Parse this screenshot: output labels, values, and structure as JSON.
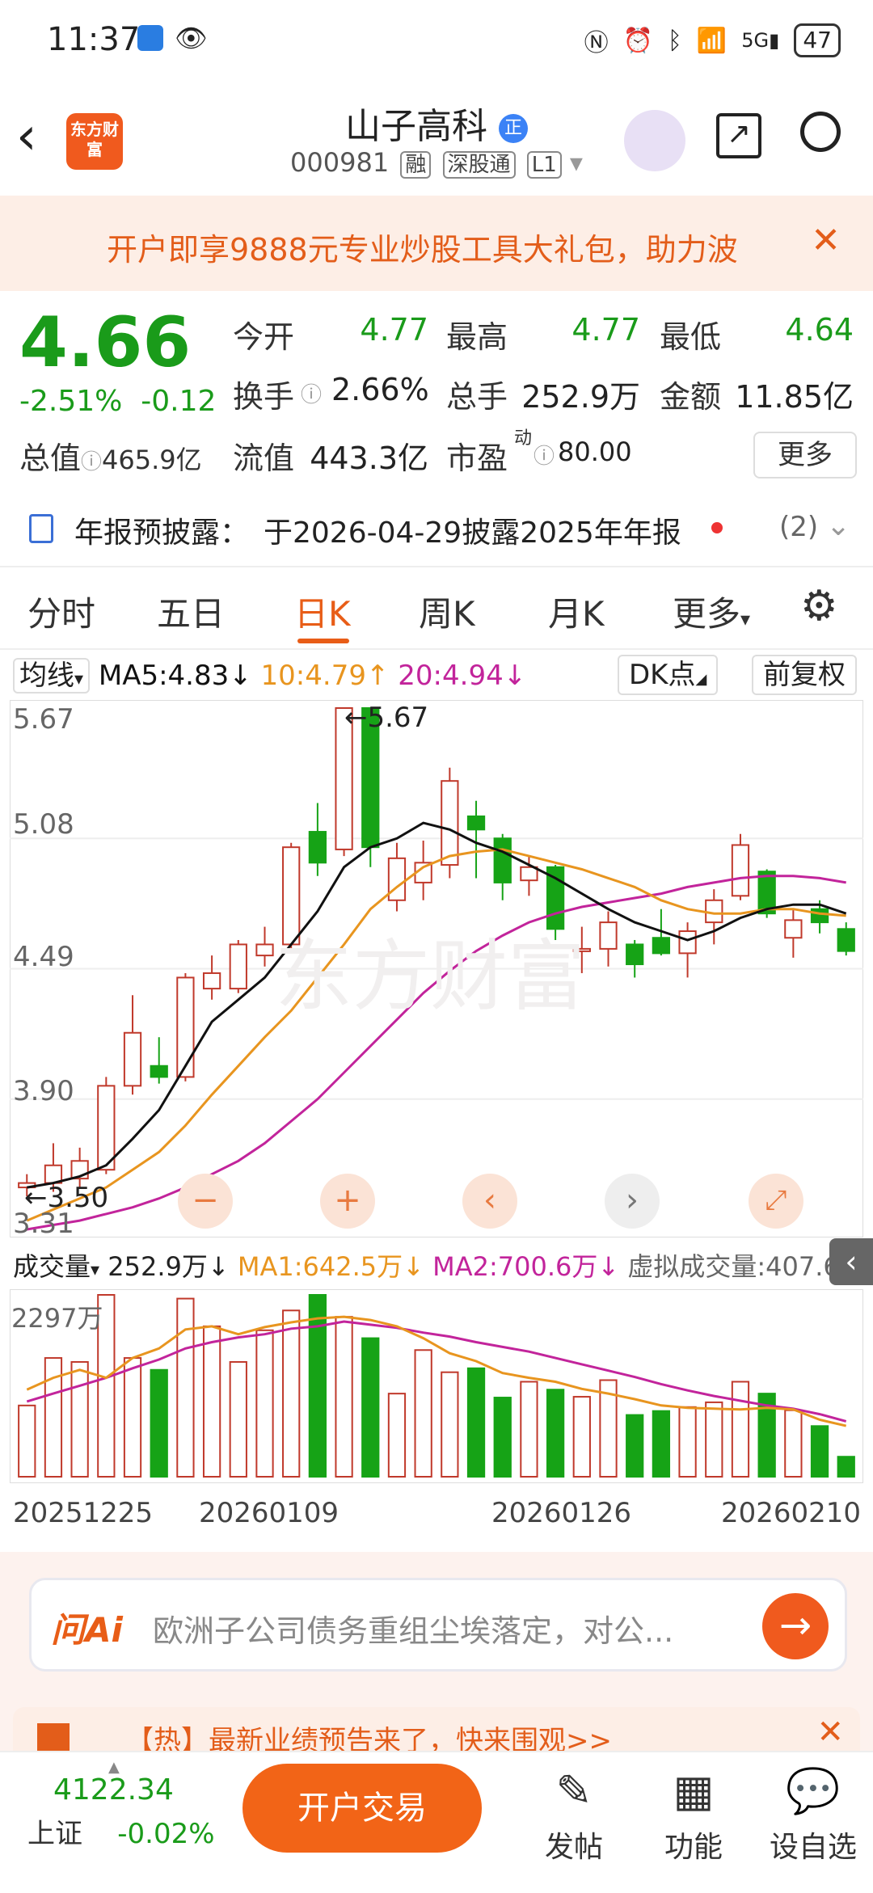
{
  "status_bar": {
    "time": "11:37",
    "battery": "47"
  },
  "header": {
    "logo": "东方财富",
    "title": "山子高科",
    "badge": "正",
    "code": "000981",
    "tags": [
      "融",
      "深股通",
      "L1"
    ]
  },
  "banner": {
    "text": "开户即享9888元专业炒股工具大礼包，助力波"
  },
  "quote": {
    "price": "4.66",
    "change_pct": "-2.51%",
    "change": "-0.12",
    "open_label": "今开",
    "open": "4.77",
    "high_label": "最高",
    "high": "4.77",
    "low_label": "最低",
    "low": "4.64",
    "turnover_label": "换手",
    "turnover": "2.66%",
    "volume_label": "总手",
    "volume": "252.9万",
    "amount_label": "金额",
    "amount": "11.85亿",
    "mktcap_label": "总值",
    "mktcap": "465.9亿",
    "float_label": "流值",
    "float": "443.3亿",
    "pe_label": "市盈",
    "pe_sup": "动",
    "pe": "80.00",
    "more": "更多"
  },
  "notice": {
    "label": "年报预披露：",
    "text": "于2026-04-29披露2025年年报",
    "count": "(2)"
  },
  "tabs": [
    "分时",
    "五日",
    "日K",
    "周K",
    "月K",
    "更多"
  ],
  "active_tab": "日K",
  "indicators": {
    "ma_selector": "均线",
    "ma5": "MA5:4.83↓",
    "ma10": "10:4.79↑",
    "ma20": "20:4.94↓",
    "dk": "DK点",
    "adjust": "前复权"
  },
  "price_axis": [
    "5.67",
    "5.08",
    "4.49",
    "3.90",
    "3.31"
  ],
  "annotations": {
    "high": "←5.67",
    "low": "←3.50"
  },
  "watermark": "东方财富",
  "volume_bar": {
    "selector": "成交量",
    "vol": "252.9万↓",
    "ma1": "MA1:642.5万↓",
    "ma2": "MA2:700.6万↓",
    "virtual": "虚拟成交量:407.6万",
    "max_label": "2297万"
  },
  "dates": [
    "20251225",
    "20260109",
    "20260126",
    "20260210"
  ],
  "ai": {
    "brand": "问Ai",
    "placeholder": "欧洲子公司债务重组尘埃落定，对公..."
  },
  "hotbar": {
    "text": "【热】最新业绩预告来了，快来围观>>"
  },
  "bottom": {
    "index_value": "4122.34",
    "index_name": "上证",
    "index_change": "-0.02%",
    "trade_button": "开户交易",
    "nav": [
      "发帖",
      "功能",
      "设自选"
    ]
  },
  "colors": {
    "up": "#c0392b",
    "down": "#16a316",
    "accent": "#f26417",
    "ma5": "#111111",
    "ma10": "#e8951f",
    "ma20": "#c2249b"
  },
  "chart_data": {
    "type": "candlestick",
    "ylim": [
      3.31,
      5.67
    ],
    "candles": [
      {
        "o": 3.5,
        "c": 3.52,
        "h": 3.56,
        "l": 3.46
      },
      {
        "o": 3.52,
        "c": 3.6,
        "h": 3.7,
        "l": 3.48
      },
      {
        "o": 3.54,
        "c": 3.62,
        "h": 3.68,
        "l": 3.5
      },
      {
        "o": 3.58,
        "c": 3.96,
        "h": 4.0,
        "l": 3.56
      },
      {
        "o": 3.96,
        "c": 4.2,
        "h": 4.37,
        "l": 3.92
      },
      {
        "o": 4.05,
        "c": 4.0,
        "h": 4.18,
        "l": 3.97
      },
      {
        "o": 4.0,
        "c": 4.45,
        "h": 4.47,
        "l": 3.98
      },
      {
        "o": 4.4,
        "c": 4.47,
        "h": 4.55,
        "l": 4.35
      },
      {
        "o": 4.4,
        "c": 4.6,
        "h": 4.62,
        "l": 4.38
      },
      {
        "o": 4.55,
        "c": 4.6,
        "h": 4.68,
        "l": 4.5
      },
      {
        "o": 4.6,
        "c": 5.04,
        "h": 5.06,
        "l": 4.58
      },
      {
        "o": 5.11,
        "c": 4.97,
        "h": 5.24,
        "l": 4.91
      },
      {
        "o": 5.03,
        "c": 5.67,
        "h": 5.67,
        "l": 5.0
      },
      {
        "o": 5.67,
        "c": 5.04,
        "h": 5.67,
        "l": 4.95
      },
      {
        "o": 4.8,
        "c": 4.99,
        "h": 5.06,
        "l": 4.75
      },
      {
        "o": 4.88,
        "c": 4.97,
        "h": 5.07,
        "l": 4.8
      },
      {
        "o": 4.96,
        "c": 5.34,
        "h": 5.4,
        "l": 4.9
      },
      {
        "o": 5.18,
        "c": 5.12,
        "h": 5.25,
        "l": 4.9
      },
      {
        "o": 5.08,
        "c": 4.88,
        "h": 5.1,
        "l": 4.8
      },
      {
        "o": 4.89,
        "c": 4.95,
        "h": 5.0,
        "l": 4.82
      },
      {
        "o": 4.95,
        "c": 4.67,
        "h": 4.96,
        "l": 4.62
      },
      {
        "o": 4.58,
        "c": 4.58,
        "h": 4.68,
        "l": 4.47
      },
      {
        "o": 4.58,
        "c": 4.7,
        "h": 4.75,
        "l": 4.5
      },
      {
        "o": 4.6,
        "c": 4.51,
        "h": 4.62,
        "l": 4.45
      },
      {
        "o": 4.63,
        "c": 4.56,
        "h": 4.76,
        "l": 4.55
      },
      {
        "o": 4.56,
        "c": 4.66,
        "h": 4.7,
        "l": 4.45
      },
      {
        "o": 4.7,
        "c": 4.8,
        "h": 4.85,
        "l": 4.6
      },
      {
        "o": 4.82,
        "c": 5.05,
        "h": 5.1,
        "l": 4.8
      },
      {
        "o": 4.93,
        "c": 4.74,
        "h": 4.94,
        "l": 4.72
      },
      {
        "o": 4.63,
        "c": 4.71,
        "h": 4.76,
        "l": 4.54
      },
      {
        "o": 4.76,
        "c": 4.7,
        "h": 4.8,
        "l": 4.65
      },
      {
        "o": 4.67,
        "c": 4.57,
        "h": 4.7,
        "l": 4.55
      }
    ],
    "ma5": [
      3.5,
      3.52,
      3.55,
      3.6,
      3.72,
      3.85,
      4.05,
      4.25,
      4.35,
      4.45,
      4.6,
      4.75,
      4.95,
      5.04,
      5.08,
      5.15,
      5.12,
      5.06,
      5.02,
      4.96,
      4.9,
      4.83,
      4.76,
      4.7,
      4.66,
      4.62,
      4.66,
      4.72,
      4.76,
      4.78,
      4.78,
      4.74
    ],
    "ma10": [
      3.35,
      3.4,
      3.45,
      3.5,
      3.58,
      3.66,
      3.78,
      3.92,
      4.05,
      4.18,
      4.3,
      4.45,
      4.6,
      4.76,
      4.86,
      4.95,
      5.0,
      5.02,
      5.03,
      5.0,
      4.97,
      4.94,
      4.9,
      4.86,
      4.8,
      4.76,
      4.74,
      4.74,
      4.76,
      4.76,
      4.74,
      4.73
    ],
    "ma20": [
      3.31,
      3.33,
      3.35,
      3.38,
      3.41,
      3.45,
      3.5,
      3.56,
      3.62,
      3.7,
      3.8,
      3.9,
      4.02,
      4.14,
      4.26,
      4.38,
      4.48,
      4.57,
      4.64,
      4.7,
      4.74,
      4.77,
      4.79,
      4.81,
      4.83,
      4.86,
      4.88,
      4.9,
      4.91,
      4.91,
      4.9,
      4.88
    ],
    "volumes": [
      900,
      1500,
      1450,
      2297,
      1500,
      1350,
      2250,
      1900,
      1450,
      1850,
      2100,
      2297,
      2020,
      1750,
      1050,
      1600,
      1320,
      1370,
      1000,
      1200,
      1100,
      1010,
      1220,
      780,
      830,
      880,
      940,
      1200,
      1050,
      840,
      640,
      252.9
    ],
    "vol_ma1": [
      1100,
      1250,
      1350,
      1250,
      1500,
      1620,
      1860,
      1900,
      1800,
      1890,
      1950,
      2000,
      2020,
      1980,
      1900,
      1750,
      1560,
      1460,
      1310,
      1250,
      1200,
      1110,
      1050,
      980,
      900,
      870,
      860,
      850,
      870,
      850,
      720,
      642.5
    ],
    "vol_ma2": [
      950,
      1050,
      1150,
      1250,
      1370,
      1480,
      1620,
      1700,
      1760,
      1800,
      1870,
      1900,
      1960,
      1920,
      1880,
      1820,
      1770,
      1700,
      1640,
      1580,
      1500,
      1420,
      1340,
      1260,
      1170,
      1090,
      1020,
      960,
      900,
      860,
      790,
      700.6
    ]
  }
}
